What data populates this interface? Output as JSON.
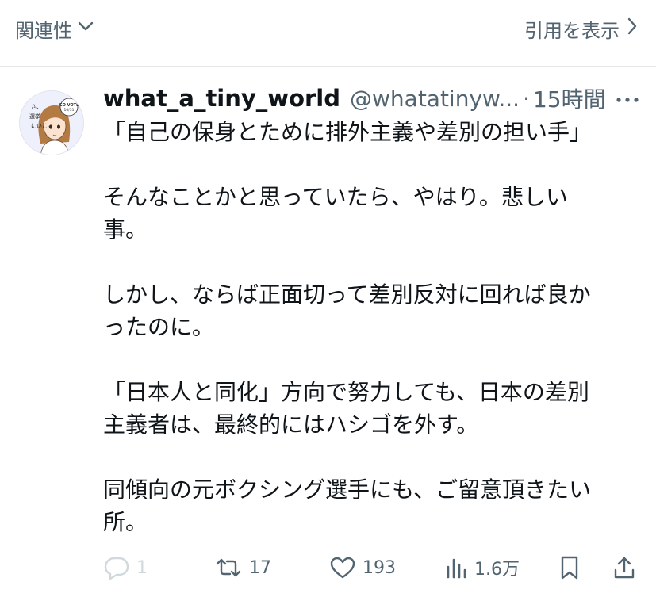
{
  "topbar": {
    "sort_label": "関連性",
    "quote_link_label": "引用を表示"
  },
  "tweet": {
    "user_name": "what_a_tiny_world",
    "handle": "@whatatinyw...",
    "separator": "·",
    "time": "15時間",
    "avatar": {
      "badge_text": "GO VOTE 10/31",
      "vertical_text": "さ、選挙にいこ。"
    },
    "paragraphs": [
      "「自己の保身とために排外主義や差別の担い手」",
      "そんなことかと思っていたら、やはり。悲しい\n事。",
      "しかし、ならば正面切って差別反対に回れば良か\nったのに。",
      "「日本人と同化」方向で努力しても、日本の差別\n主義者は、最終的にはハシゴを外す。",
      "同傾向の元ボクシング選手にも、ご留意頂きたい\n所。"
    ],
    "actions": {
      "reply_count": "1",
      "retweet_count": "17",
      "like_count": "193",
      "views_count": "1.6万"
    }
  },
  "icons": {
    "sort": "chevron-down-icon",
    "quote": "chevron-right-icon",
    "more": "more-dots-icon",
    "reply": "reply-icon",
    "retweet": "retweet-icon",
    "like": "heart-icon",
    "views": "views-bars-icon",
    "bookmark": "bookmark-icon",
    "share": "share-icon"
  },
  "colors": {
    "text": "#0f1419",
    "secondary": "#536471",
    "divider": "#e6e8ea"
  }
}
